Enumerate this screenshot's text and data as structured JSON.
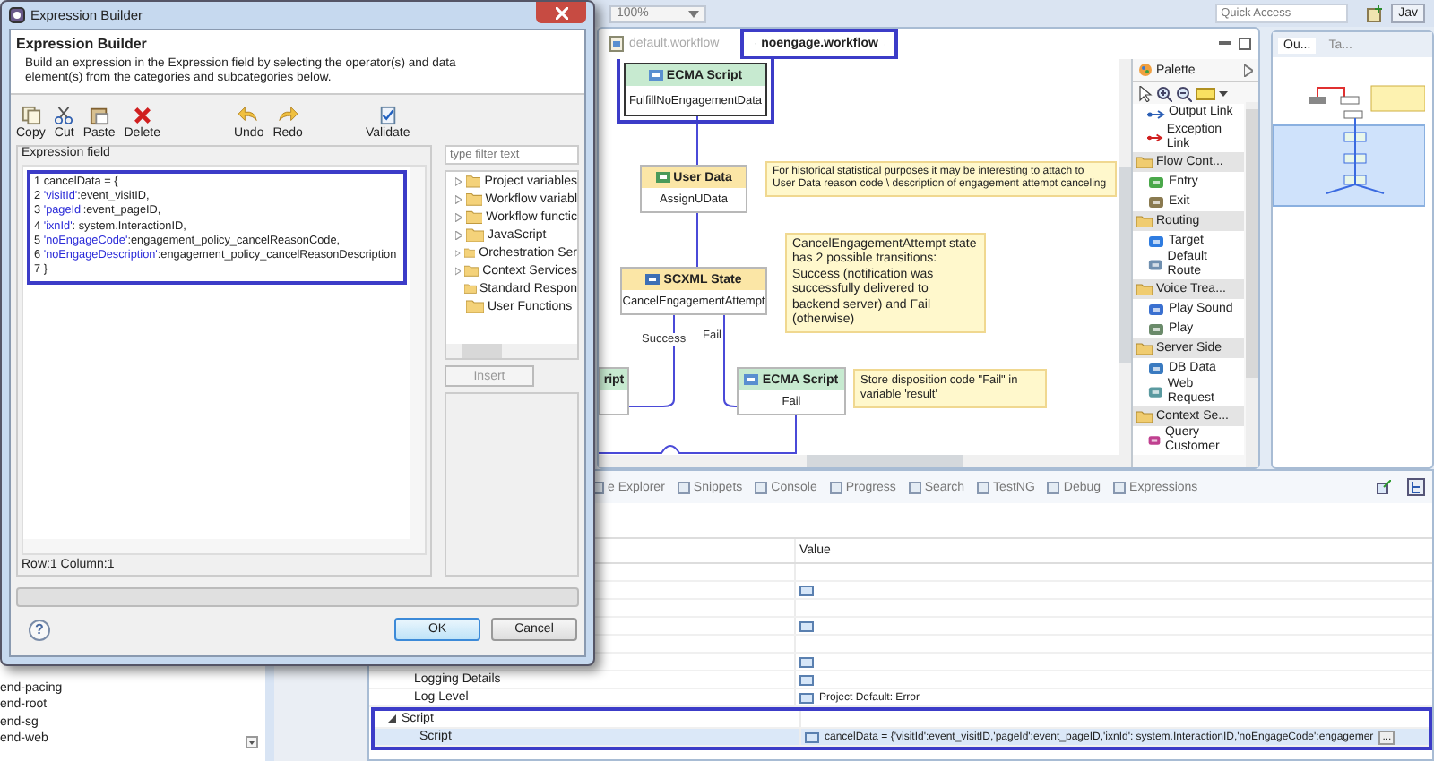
{
  "ide": {
    "zoom": "100%",
    "quick_access": {
      "placeholder": "Quick Access"
    },
    "perspective": "Jav"
  },
  "editor_tabs": [
    {
      "label": "default.workflow",
      "selected": false
    },
    {
      "label": "noengage.workflow",
      "selected": true
    }
  ],
  "canvas": {
    "nodes": [
      {
        "kind": "ecma",
        "title": "ECMA Script",
        "name": "FulfillNoEngagementData",
        "selected": true
      },
      {
        "kind": "userdata",
        "title": "User Data",
        "name": "AssignUData",
        "selected": false
      },
      {
        "kind": "scxml",
        "title": "SCXML State",
        "name": "CancelEngagementAttempt",
        "selected": false
      },
      {
        "kind": "ecma",
        "title": "ript",
        "selected": false
      },
      {
        "kind": "ecma",
        "title": "ECMA Script",
        "name": "Fail",
        "selected": false
      }
    ],
    "notes": [
      "For historical statistical purposes it may be interesting to attach to User Data reason code \\ description of engagement attempt canceling",
      "CancelEngagementAttempt state has 2 possible transitions: Success (notification was successfully delivered to backend server) and Fail (otherwise)",
      "Store disposition code \"Fail\" in variable 'result'"
    ],
    "edge_labels": [
      "Success",
      "Fail"
    ]
  },
  "palette": {
    "title": "Palette",
    "sections": [
      {
        "items": [
          {
            "kind": "output-link",
            "label": "Output Link"
          },
          {
            "kind": "exception-link",
            "label": "Exception Link"
          }
        ]
      },
      {
        "label": "Flow Cont...",
        "items": [
          {
            "kind": "entry",
            "label": "Entry"
          },
          {
            "kind": "exit",
            "label": "Exit"
          }
        ]
      },
      {
        "label": "Routing",
        "items": [
          {
            "kind": "target",
            "label": "Target"
          },
          {
            "kind": "route",
            "label": "Default Route"
          }
        ]
      },
      {
        "label": "Voice Trea...",
        "items": [
          {
            "kind": "sound",
            "label": "Play Sound"
          },
          {
            "kind": "play",
            "label": "Play"
          }
        ]
      },
      {
        "label": "Server Side",
        "items": [
          {
            "kind": "db",
            "label": "DB Data"
          },
          {
            "kind": "web",
            "label": "Web Request"
          }
        ]
      },
      {
        "label": "Context Se...",
        "items": [
          {
            "kind": "query",
            "label": "Query Customer"
          }
        ]
      }
    ]
  },
  "outline": {
    "tabs": [
      {
        "label": "Ou...",
        "selected": true
      },
      {
        "label": "Ta...",
        "selected": false
      }
    ]
  },
  "explorer": {
    "items": [
      "end-pacing",
      "end-root",
      "end-sg",
      "end-web"
    ]
  },
  "bottom": {
    "tabs": [
      "e Explorer",
      "Snippets",
      "Console",
      "Progress",
      "Search",
      "TestNG",
      "Debug",
      "Expressions"
    ],
    "properties": {
      "value_header": "Value",
      "rows": [
        {
          "kind": "row",
          "has_icon": false,
          "selected": false
        },
        {
          "kind": "row",
          "has_icon": true,
          "selected": false
        },
        {
          "kind": "row",
          "has_icon": false,
          "selected": false
        },
        {
          "kind": "row",
          "has_icon": true,
          "selected": false
        },
        {
          "kind": "row",
          "has_icon": false,
          "selected": false
        },
        {
          "kind": "row",
          "has_icon": true,
          "selected": false
        },
        {
          "kind": "row",
          "label": "Logging Details",
          "has_icon": true,
          "selected": false
        },
        {
          "kind": "row",
          "label": "Log Level",
          "has_icon": true,
          "value": "Project Default: Error",
          "selected": false
        },
        {
          "kind": "group",
          "label": "Script",
          "expanded": true,
          "selected": false
        },
        {
          "kind": "row",
          "label": "Script",
          "has_icon": true,
          "value": "cancelData = {'visitId':event_visitID,'pageId':event_pageID,'ixnId': system.InteractionID,'noEngageCode':engagemer",
          "edit_button": "...",
          "selected": true
        }
      ]
    }
  },
  "dialog": {
    "title": "Expression Builder",
    "heading": "Expression Builder",
    "description": "Build an expression in the Expression field by selecting the operator(s) and data element(s) from the categories and subcategories below.",
    "toolbar": [
      {
        "kind": "copy",
        "label": "Copy"
      },
      {
        "kind": "cut",
        "label": "Cut"
      },
      {
        "kind": "paste",
        "label": "Paste"
      },
      {
        "kind": "delete",
        "label": "Delete"
      },
      {
        "kind": "undo",
        "label": "Undo"
      },
      {
        "kind": "redo",
        "label": "Redo"
      },
      {
        "kind": "validate",
        "label": "Validate"
      }
    ],
    "expression_label": "Expression field",
    "code_lines": [
      {
        "number": "1",
        "text": "cancelData = {"
      },
      {
        "number": "2",
        "key": "'visitId'",
        "text": ":event_visitID,"
      },
      {
        "number": "3",
        "key": "'pageId'",
        "text": ":event_pageID,"
      },
      {
        "number": "4",
        "key": "'ixnId'",
        "text": ": system.InteractionID,"
      },
      {
        "number": "5",
        "key": "'noEngageCode'",
        "text": ":engagement_policy_cancelReasonCode,"
      },
      {
        "number": "6",
        "key": "'noEngageDescription'",
        "text": ":engagement_policy_cancelReasonDescription"
      },
      {
        "number": "7",
        "text": "}"
      }
    ],
    "status": "Row:1 Column:1",
    "filter": {
      "placeholder": "type filter text"
    },
    "tree": [
      {
        "label": "Project variables",
        "expandable": true
      },
      {
        "label": "Workflow variabl",
        "expandable": true
      },
      {
        "label": "Workflow functic",
        "expandable": true
      },
      {
        "label": "JavaScript",
        "expandable": true
      },
      {
        "label": "Orchestration Ser",
        "expandable": true
      },
      {
        "label": "Context Services",
        "expandable": true
      },
      {
        "label": "Standard Respon",
        "expandable": false
      },
      {
        "label": "User Functions",
        "expandable": false
      }
    ],
    "insert": {
      "label": "Insert",
      "disabled": true
    },
    "help": "?",
    "buttons": [
      {
        "label": "OK",
        "default": true
      },
      {
        "label": "Cancel",
        "default": false
      }
    ]
  }
}
